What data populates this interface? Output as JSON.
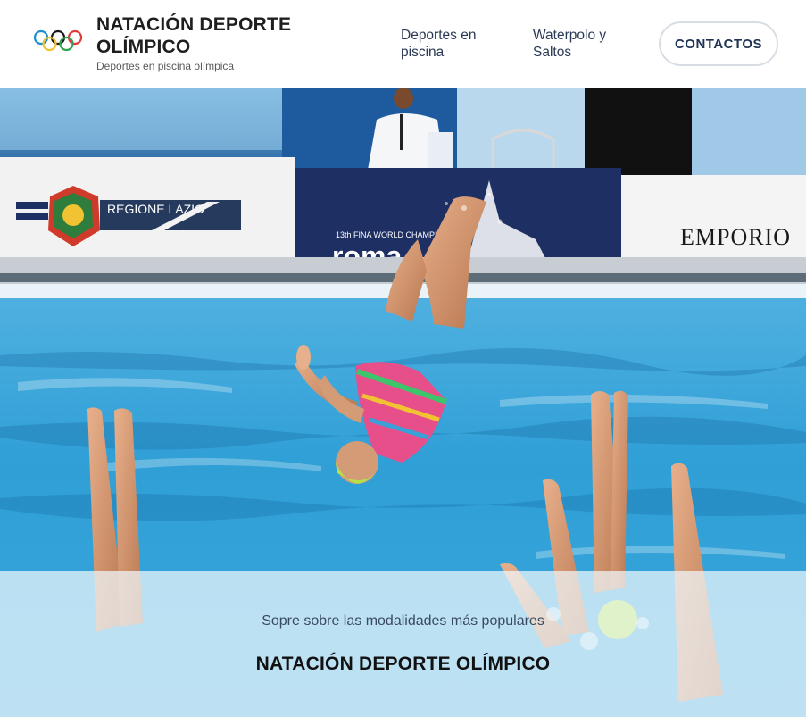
{
  "header": {
    "title": "NATACIÓN DEPORTE OLÍMPICO",
    "subtitle": "Deportes en piscina olímpica",
    "nav": [
      {
        "label": "Deportes en piscina"
      },
      {
        "label": "Waterpolo y Saltos"
      }
    ],
    "contact_label": "CONTACTOS"
  },
  "hero": {
    "banner_left": "REGIONE LAZIO",
    "banner_center_small": "13th FINA WORLD CHAMPIONSHIPS",
    "banner_center_big": "roma",
    "banner_right": "EMPORIO"
  },
  "caption": {
    "subtitle": "Sopre sobre las modalidades más populares",
    "title": "NATACIÓN DEPORTE OLÍMPICO"
  },
  "colors": {
    "brand_text": "#1e1e1e",
    "nav_text": "#2b3a55",
    "button_text": "#1f3354",
    "pool_blue": "#2f9fd6"
  }
}
